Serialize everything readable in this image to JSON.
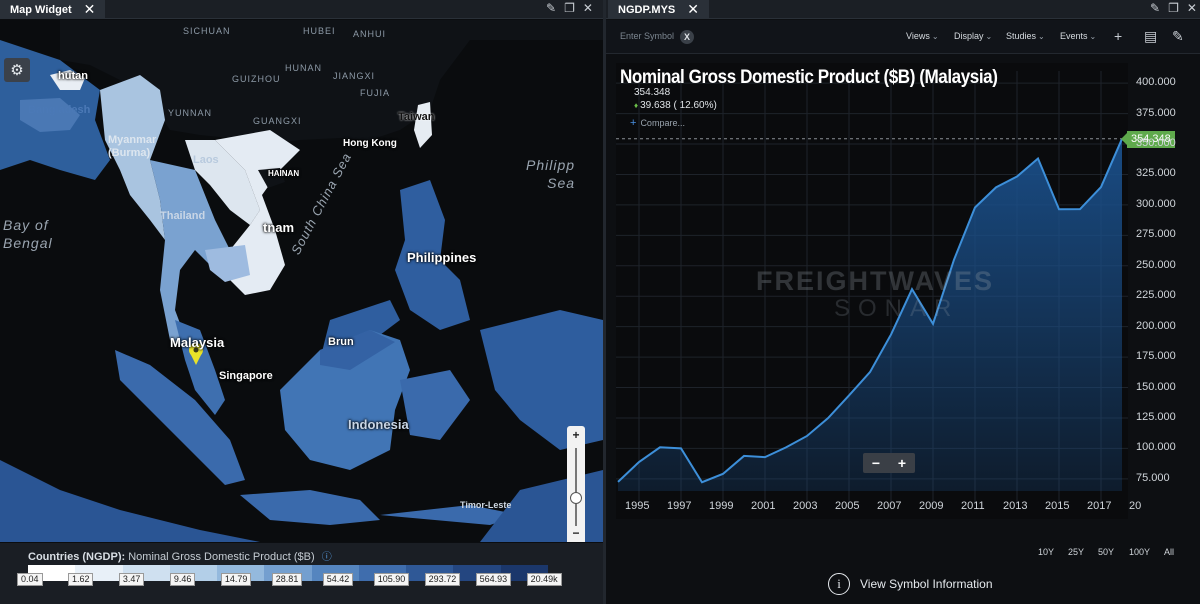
{
  "left_panel": {
    "tab_label": "Map Widget",
    "map_labels": {
      "sichuan": "SICHUAN",
      "hubei": "HUBEI",
      "anhui": "ANHUI",
      "hunan": "HUNAN",
      "jiangxi": "JIANGXI",
      "fujian": "FUJIA",
      "guizhou": "GUIZHOU",
      "yunnan": "YUNNAN",
      "guangxi": "GUANGXI",
      "bhutan": "hutan",
      "bangladesh": "Bangladesh",
      "myanmar": "Myanmar\n(Burma)",
      "laos": "Laos",
      "thailand": "Thailand",
      "vietnam": "tnam",
      "hainan": "HAINAN",
      "hong_kong": "Hong Kong",
      "taiwan": "Taiwan",
      "philippine_sea": "Philipp\nSea",
      "bay_of_bengal": "Bay of\nBengal",
      "south_china_sea": "South China Sea",
      "philippines": "Philippines",
      "malaysia": "Malaysia",
      "singapore": "Singapore",
      "brunei": "Brun",
      "indonesia": "Indonesia",
      "timor_leste": "Timor-Leste"
    },
    "legend": {
      "title_prefix": "Countries (NGDP):",
      "title_text": "Nominal Gross Domestic Product ($B)",
      "info_icon": "info-icon",
      "colors": [
        "#ffffff",
        "#e8f0f8",
        "#cfe0f0",
        "#b3cfe8",
        "#94b9dd",
        "#749fcf",
        "#5585bf",
        "#3f6dad",
        "#2f5896",
        "#244680",
        "#1b376b"
      ],
      "ticks": [
        "0.04",
        "1.62",
        "3.47",
        "9.46",
        "14.79",
        "28.81",
        "54.42",
        "105.90",
        "293.72",
        "564.93",
        "20.49k"
      ]
    }
  },
  "right_panel": {
    "tab_label": "NGDP.MYS",
    "symbol_placeholder": "Enter Symbol",
    "symbol_clear": "X",
    "menus": [
      "Views",
      "Display",
      "Studies",
      "Events"
    ],
    "chart": {
      "title": "Nominal Gross Domestic Product ($B) (Malaysia)",
      "last_value": "354.348",
      "change": "39.638 ( 12.60%)",
      "compare_label": "Compare...",
      "price_flag": "354.348",
      "watermark_line1": "FREIGHTWAVES",
      "watermark_line2": "SONAR"
    },
    "chart_data": {
      "type": "area",
      "title": "Nominal Gross Domestic Product ($B) (Malaysia)",
      "x": [
        1994,
        1995,
        1996,
        1997,
        1998,
        1999,
        2000,
        2001,
        2002,
        2003,
        2004,
        2005,
        2006,
        2007,
        2008,
        2009,
        2010,
        2011,
        2012,
        2013,
        2014,
        2015,
        2016,
        2017,
        2018
      ],
      "values": [
        72.5,
        88.8,
        100.9,
        100.0,
        72.2,
        79.1,
        93.8,
        92.8,
        100.8,
        110.2,
        124.8,
        143.5,
        162.7,
        193.5,
        230.8,
        202.3,
        255.0,
        297.9,
        314.4,
        323.3,
        338.1,
        296.4,
        296.5,
        314.7,
        354.3
      ],
      "y_ticks": [
        "400.000",
        "375.000",
        "350.000",
        "325.000",
        "300.000",
        "275.000",
        "250.000",
        "225.000",
        "200.000",
        "175.000",
        "150.000",
        "125.000",
        "100.000",
        "75.000"
      ],
      "x_ticks": [
        "1995",
        "1997",
        "1999",
        "2001",
        "2003",
        "2005",
        "2007",
        "2009",
        "2011",
        "2013",
        "2015",
        "2017",
        "20"
      ],
      "ylim": [
        65,
        410
      ],
      "line_color": "#3d8fd9",
      "fill_color": "#1a4f8a",
      "grid": true,
      "last_value_line": 354.348
    },
    "zoom_minus": "−",
    "zoom_plus": "+",
    "ranges": [
      "10Y",
      "25Y",
      "50Y",
      "100Y",
      "All"
    ],
    "view_info": "View Symbol Information"
  }
}
